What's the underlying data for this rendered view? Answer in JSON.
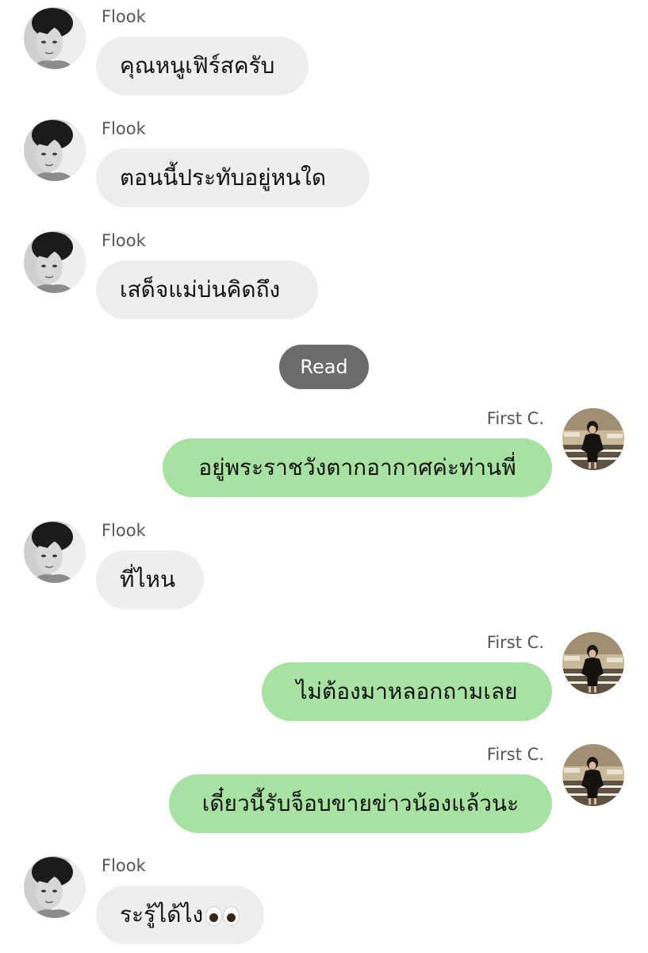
{
  "status": {
    "read_label": "Read"
  },
  "messages": [
    {
      "direction": "in",
      "sender": "Flook",
      "text": "คุณหนูเฟิร์สครับ"
    },
    {
      "direction": "in",
      "sender": "Flook",
      "text": "ตอนนี้ประทับอยู่หนใด"
    },
    {
      "direction": "in",
      "sender": "Flook",
      "text": "เสด็จแม่บ่นคิดถึง"
    },
    {
      "direction": "out",
      "sender": "First C.",
      "text": "อยู่พระราชวังตากอากาศค่ะท่านพี่"
    },
    {
      "direction": "in",
      "sender": "Flook",
      "text": "ที่ไหน"
    },
    {
      "direction": "out",
      "sender": "First C.",
      "text": "ไม่ต้องมาหลอกถามเลย"
    },
    {
      "direction": "out",
      "sender": "First C.",
      "text": "เดี๋ยวนี้รับจ็อบขายข่าวน้องแล้วนะ"
    },
    {
      "direction": "in",
      "sender": "Flook",
      "text": "ระรู้ได้ไง",
      "emoji": "eyes-emoji"
    }
  ],
  "icons": {
    "incoming_avatar": "avatar-flook-photo",
    "outgoing_avatar": "avatar-first-photo",
    "emoji": "eyes-emoji"
  },
  "colors": {
    "incoming_bubble": "#eeeeee",
    "outgoing_bubble": "#a8e2a2",
    "read_pill": "#6b6b6b",
    "background": "#ffffff"
  }
}
